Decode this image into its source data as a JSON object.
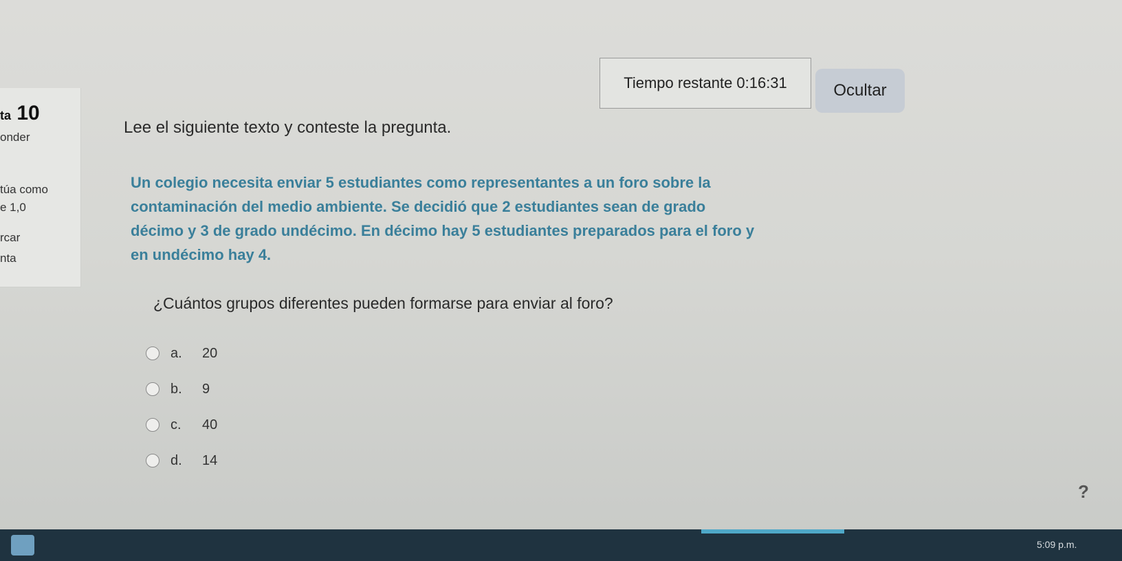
{
  "left_panel": {
    "question_prefix": "ta",
    "question_number": "10",
    "lines": [
      "onder",
      "túa como",
      "e 1,0",
      "rcar",
      "nta"
    ]
  },
  "timer": {
    "label": "Tiempo restante",
    "value": "0:16:31",
    "hide_label": "Ocultar"
  },
  "instruction": "Lee el siguiente texto y conteste la pregunta.",
  "prompt_lines": [
    "Un colegio necesita enviar 5 estudiantes como representantes a un foro sobre la",
    "contaminación del medio ambiente. Se decidió que 2 estudiantes sean de grado",
    "décimo y 3 de grado undécimo. En décimo hay 5 estudiantes preparados para el foro y",
    "en undécimo hay 4."
  ],
  "question": "¿Cuántos grupos diferentes pueden formarse para enviar al foro?",
  "options": [
    {
      "letter": "a.",
      "value": "20"
    },
    {
      "letter": "b.",
      "value": "9"
    },
    {
      "letter": "c.",
      "value": "40"
    },
    {
      "letter": "d.",
      "value": "14"
    }
  ],
  "help_icon": "question-mark-icon",
  "help_glyph": "?",
  "taskbar": {
    "clock": "5:09 p.m."
  }
}
